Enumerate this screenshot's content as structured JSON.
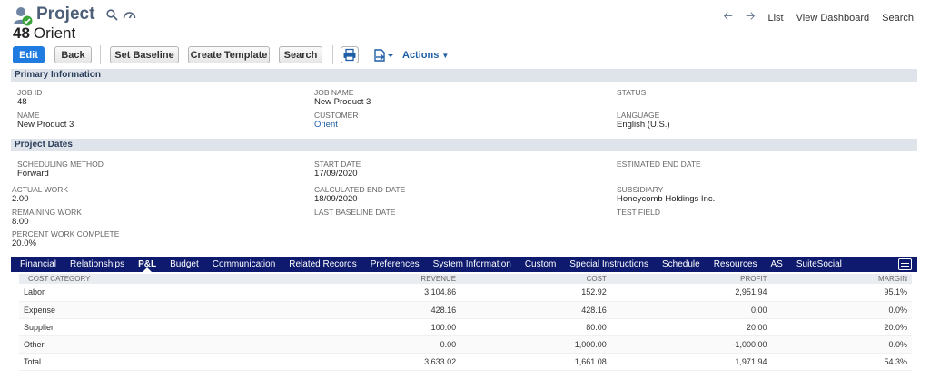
{
  "header": {
    "title": "Project",
    "nav_links": [
      "List",
      "View Dashboard",
      "Search"
    ]
  },
  "record": {
    "id": "48",
    "name": "Orient"
  },
  "toolbar": {
    "edit": "Edit",
    "back": "Back",
    "set_baseline": "Set Baseline",
    "create_template": "Create Template",
    "search": "Search",
    "actions": "Actions"
  },
  "primary_info": {
    "section_title": "Primary Information",
    "job_id_label": "JOB ID",
    "job_id_value": "48",
    "job_name_label": "JOB NAME",
    "job_name_value": "New Product 3",
    "status_label": "STATUS",
    "name_label": "NAME",
    "name_value": "New Product 3",
    "customer_label": "CUSTOMER",
    "customer_value": "Orient",
    "language_label": "LANGUAGE",
    "language_value": "English (U.S.)"
  },
  "project_dates": {
    "section_title": "Project Dates",
    "scheduling_label": "SCHEDULING METHOD",
    "scheduling_value": "Forward",
    "start_label": "START DATE",
    "start_value": "17/09/2020",
    "est_end_label": "ESTIMATED END DATE",
    "actual_work_label": "ACTUAL WORK",
    "actual_work_value": "2.00",
    "calc_end_label": "CALCULATED END DATE",
    "calc_end_value": "18/09/2020",
    "subsidiary_label": "SUBSIDIARY",
    "subsidiary_value": "Honeycomb Holdings Inc.",
    "remaining_label": "REMAINING WORK",
    "remaining_value": "8.00",
    "last_baseline_label": "LAST BASELINE DATE",
    "test_field_label": "TEST FIELD",
    "percent_label": "PERCENT WORK COMPLETE",
    "percent_value": "20.0%"
  },
  "tabs": [
    "Financial",
    "Relationships",
    "P&L",
    "Budget",
    "Communication",
    "Related Records",
    "Preferences",
    "System Information",
    "Custom",
    "Special Instructions",
    "Schedule",
    "Resources",
    "AS",
    "SuiteSocial"
  ],
  "active_tab": "P&L",
  "pl_table": {
    "headers": [
      "COST CATEGORY",
      "REVENUE",
      "COST",
      "PROFIT",
      "MARGIN"
    ],
    "rows": [
      [
        "Labor",
        "3,104.86",
        "152.92",
        "2,951.94",
        "95.1%"
      ],
      [
        "Expense",
        "428.16",
        "428.16",
        "0.00",
        "0.0%"
      ],
      [
        "Supplier",
        "100.00",
        "80.00",
        "20.00",
        "20.0%"
      ],
      [
        "Other",
        "0.00",
        "1,000.00",
        "-1,000.00",
        "0.0%"
      ],
      [
        "Total",
        "3,633.02",
        "1,661.08",
        "1,971.94",
        "54.3%"
      ]
    ]
  },
  "colors": {
    "primary_button": "#1f7be0",
    "tab_bar": "#0d1a6e",
    "section_bar": "#dfe4eb",
    "link": "#1f5fa8"
  }
}
